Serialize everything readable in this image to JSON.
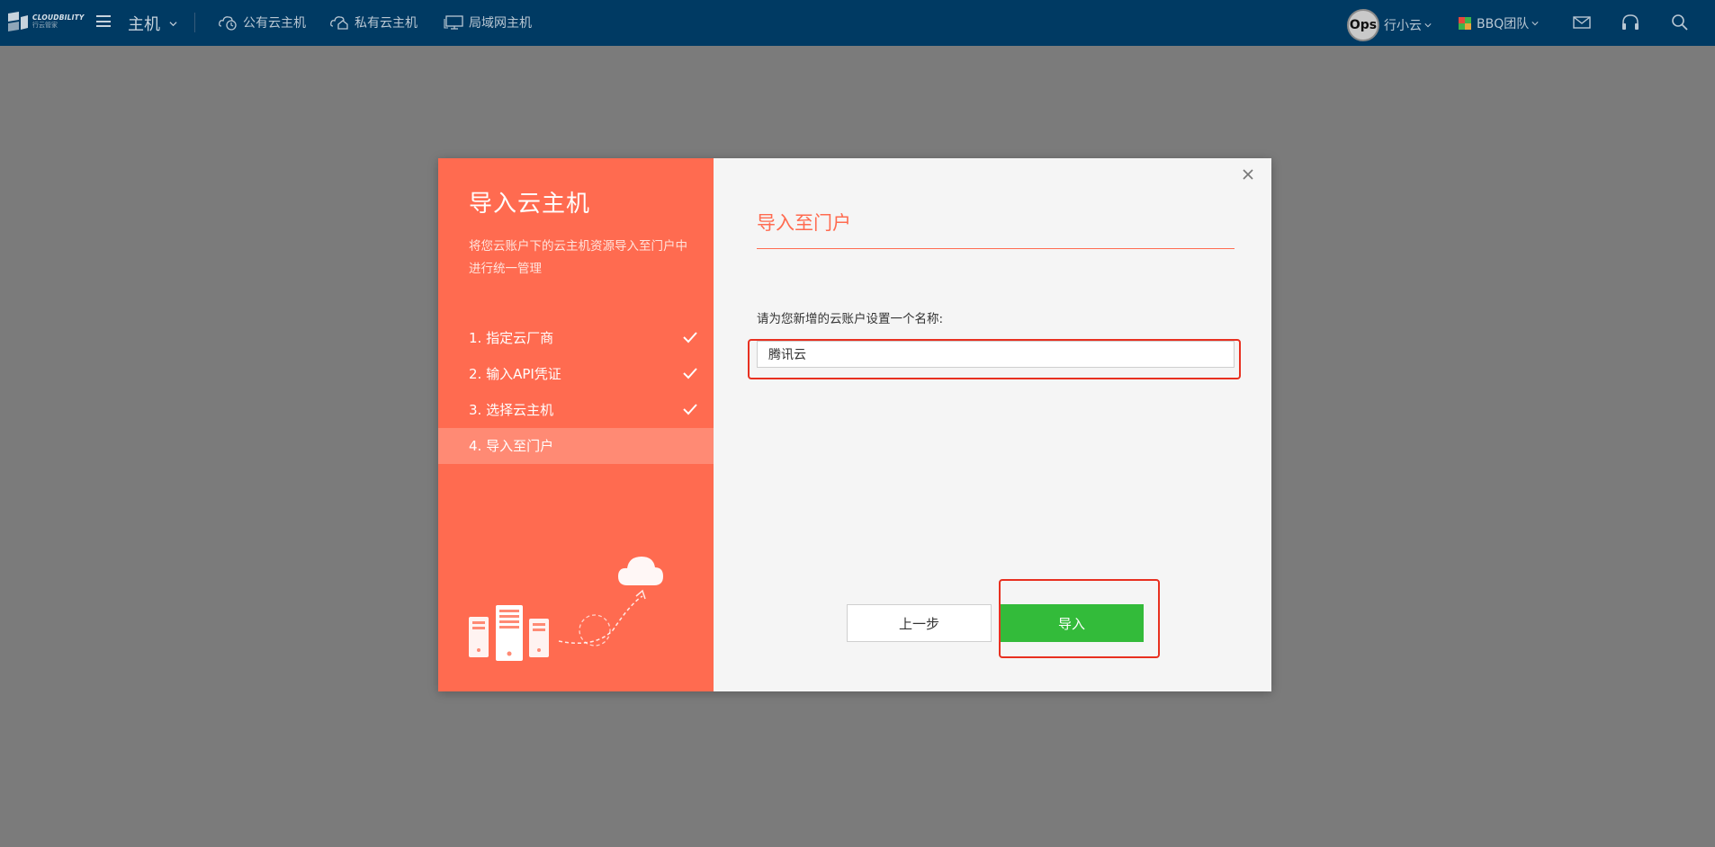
{
  "header": {
    "logo_en": "CLOUDBILITY",
    "logo_cn": "行云管家",
    "module_label": "主机",
    "nav": [
      {
        "label": "公有云主机",
        "icon": "cloud-host-icon"
      },
      {
        "label": "私有云主机",
        "icon": "private-cloud-icon"
      },
      {
        "label": "局域网主机",
        "icon": "lan-host-icon"
      }
    ],
    "avatar_text": "Ops",
    "user_name": "行小云",
    "team_name": "BBQ团队",
    "icons": [
      "mail-icon",
      "headset-icon",
      "search-icon"
    ],
    "colors": {
      "bar": "#003a63",
      "text": "#c7d3dd"
    }
  },
  "modal": {
    "left": {
      "title": "导入云主机",
      "description": "将您云账户下的云主机资源导入至门户中进行统一管理",
      "steps": [
        {
          "label": "1. 指定云厂商",
          "done": true
        },
        {
          "label": "2. 输入API凭证",
          "done": true
        },
        {
          "label": "3. 选择云主机",
          "done": true
        },
        {
          "label": "4. 导入至门户",
          "done": false,
          "active": true
        }
      ],
      "accent": "#ff6b50"
    },
    "right": {
      "title": "导入至门户",
      "prompt": "请为您新增的云账户设置一个名称:",
      "input_value": "腾讯云",
      "prev_label": "上一步",
      "import_label": "导入",
      "import_color": "#33bb3a"
    }
  }
}
